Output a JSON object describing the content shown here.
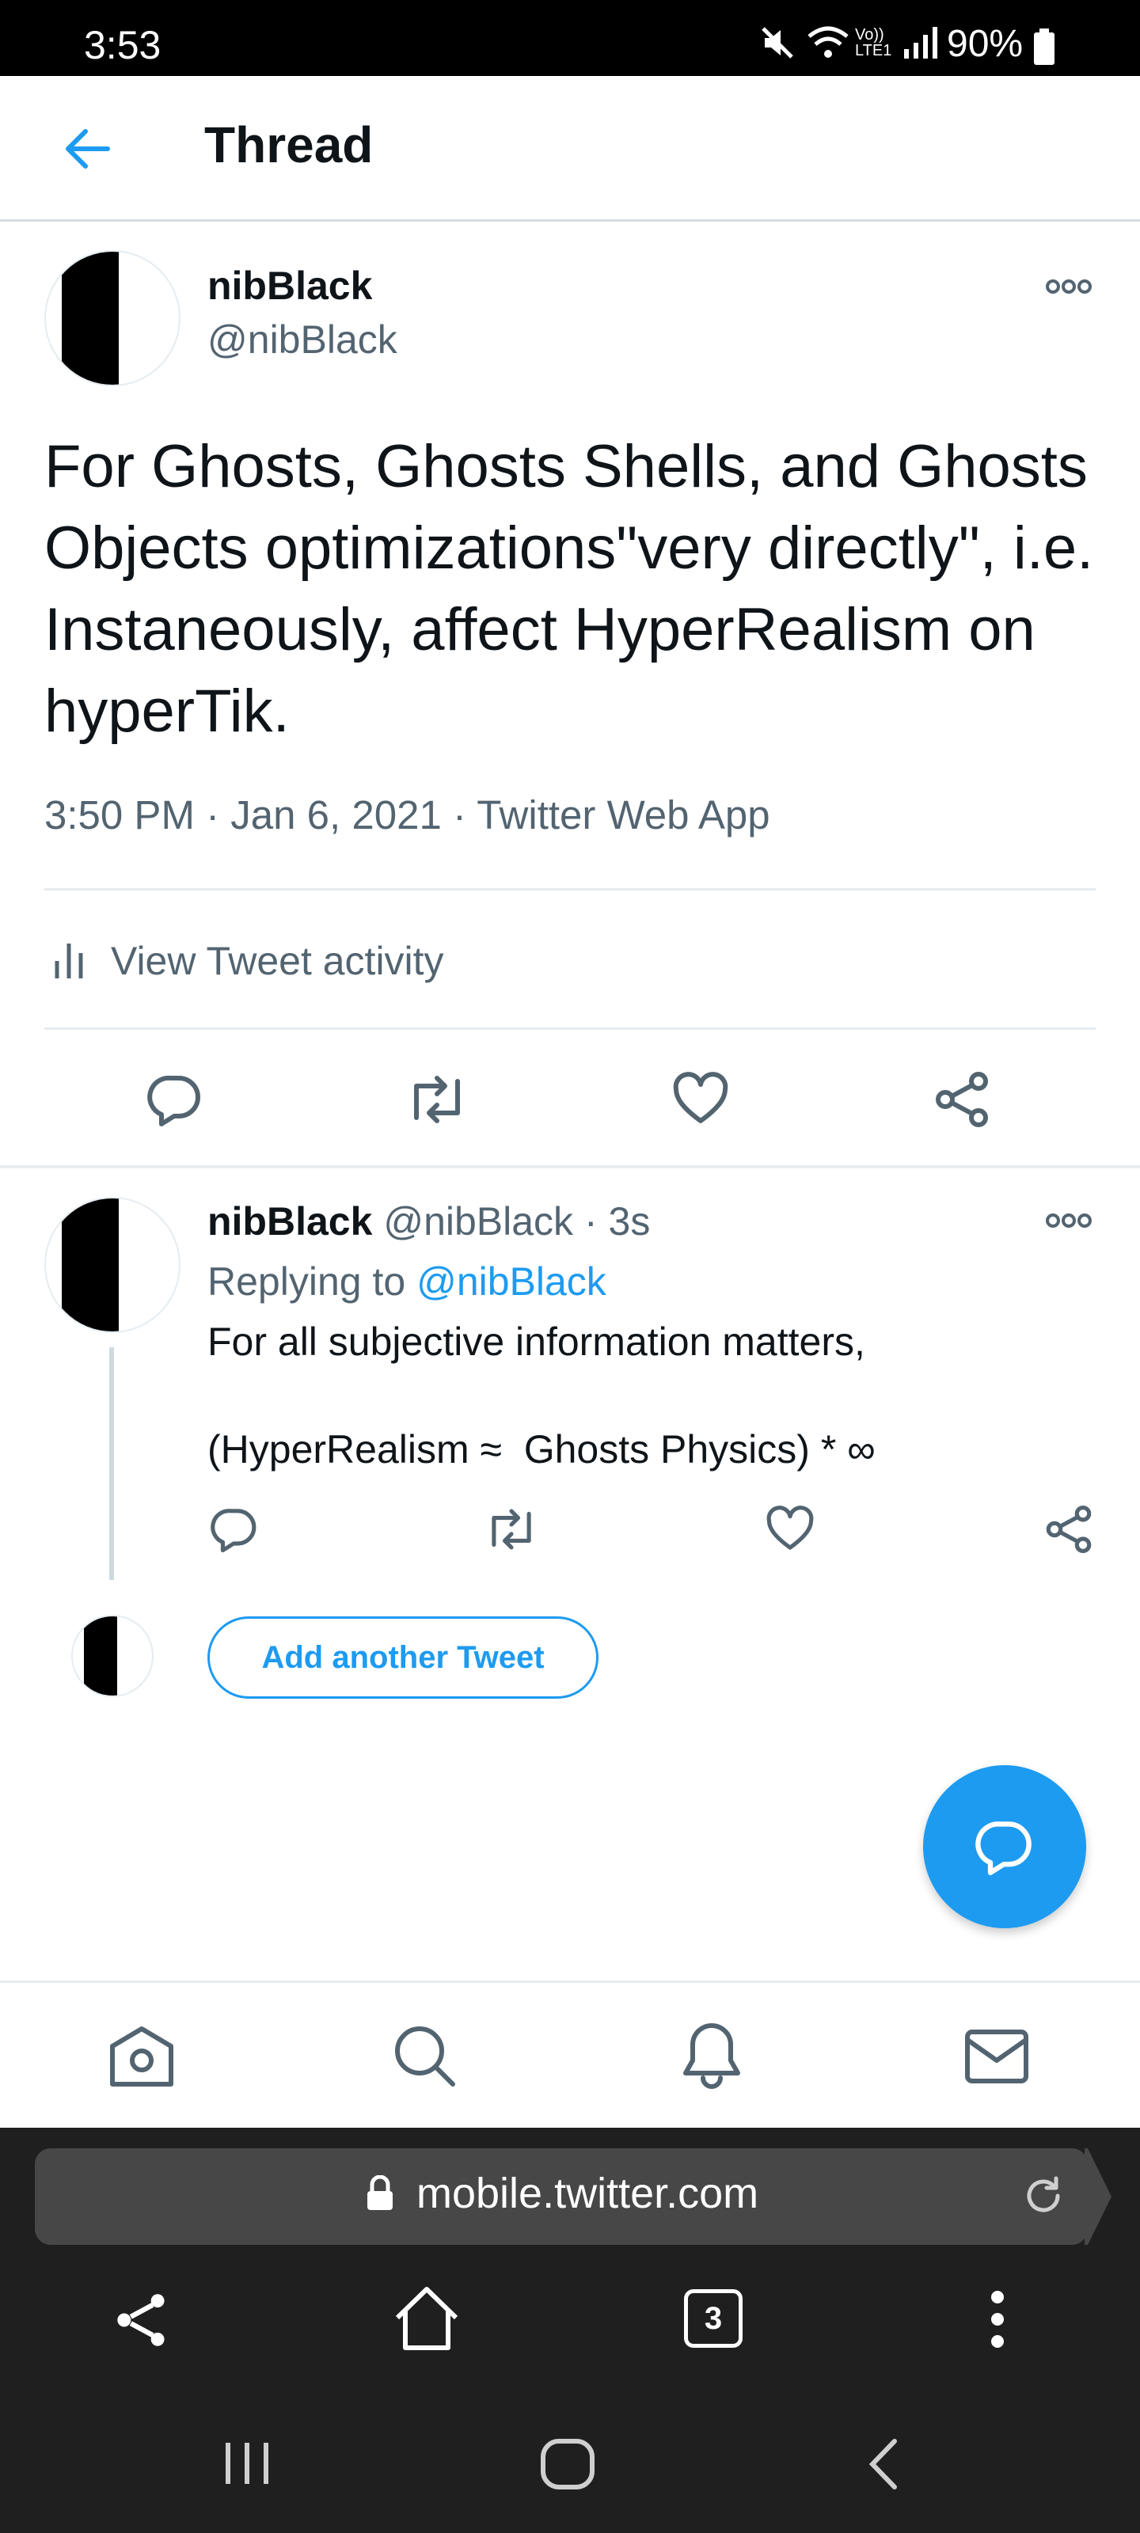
{
  "status_bar": {
    "time": "3:53",
    "battery": "90%",
    "signal_label": "Vo)) LTE1"
  },
  "header": {
    "title": "Thread"
  },
  "main_tweet": {
    "display_name": "nibBlack",
    "handle": "@nibBlack",
    "text": "For Ghosts, Ghosts Shells, and Ghosts Objects optimizations\"very directly\", i.e. Instaneously, affect HyperRealism on hyperTik.",
    "timestamp": "3:50 PM · Jan 6, 2021 · Twitter Web App",
    "activity_label": "View Tweet activity"
  },
  "reply_tweet": {
    "display_name": "nibBlack",
    "handle": "@nibBlack",
    "time": "· 3s",
    "replying_prefix": "Replying to",
    "replying_handle": "@nibBlack",
    "text_line1": "For all subjective information matters,",
    "text_line2": "(HyperRealism ≈  Ghosts Physics) * ∞"
  },
  "add_tweet_label": "Add another Tweet",
  "browser": {
    "url": "mobile.twitter.com",
    "tab_count": "3"
  },
  "colors": {
    "accent": "#1d9bf0",
    "text": "#0f1419",
    "muted": "#536471",
    "chrome": "#1f1f1f"
  },
  "icons": {
    "main_actions": [
      "reply-icon",
      "retweet-icon",
      "like-icon",
      "share-icon"
    ],
    "nav": [
      "home-icon",
      "search-icon",
      "notifications-icon",
      "messages-icon"
    ]
  }
}
